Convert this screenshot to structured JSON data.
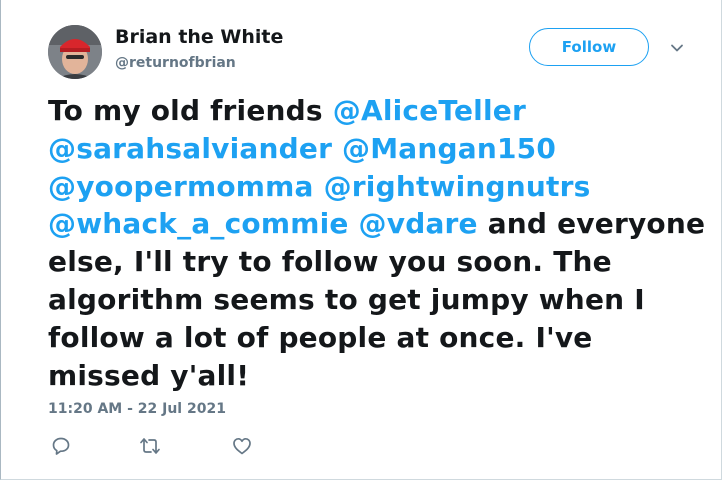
{
  "author": {
    "name": "Brian the White",
    "handle": "@returnofbrian",
    "avatar_icon": "profile-photo"
  },
  "header": {
    "follow_label": "Follow",
    "more_icon": "chevron-down-icon"
  },
  "tweet": {
    "segments": [
      {
        "text": "To my old friends ",
        "type": "text"
      },
      {
        "text": "@AliceTeller",
        "type": "mention"
      },
      {
        "text": " ",
        "type": "text"
      },
      {
        "text": "@sarahsalviander",
        "type": "mention"
      },
      {
        "text": " ",
        "type": "text"
      },
      {
        "text": "@Mangan150",
        "type": "mention"
      },
      {
        "text": " ",
        "type": "text"
      },
      {
        "text": "@yoopermomma",
        "type": "mention"
      },
      {
        "text": " ",
        "type": "text"
      },
      {
        "text": "@rightwingnutrs",
        "type": "mention"
      },
      {
        "text": " ",
        "type": "text"
      },
      {
        "text": "@whack_a_commie",
        "type": "mention"
      },
      {
        "text": " ",
        "type": "text"
      },
      {
        "text": "@vdare",
        "type": "mention"
      },
      {
        "text": " and everyone else, I'll try to follow you soon. The algorithm seems to get jumpy when I follow a lot of people at once. I've missed y'all!",
        "type": "text"
      }
    ],
    "timestamp": "11:20 AM - 22 Jul 2021"
  },
  "actions": [
    {
      "name": "reply-icon"
    },
    {
      "name": "retweet-icon"
    },
    {
      "name": "like-icon"
    }
  ],
  "colors": {
    "accent": "#1da1f2",
    "text": "#14171a",
    "secondary": "#657786"
  }
}
